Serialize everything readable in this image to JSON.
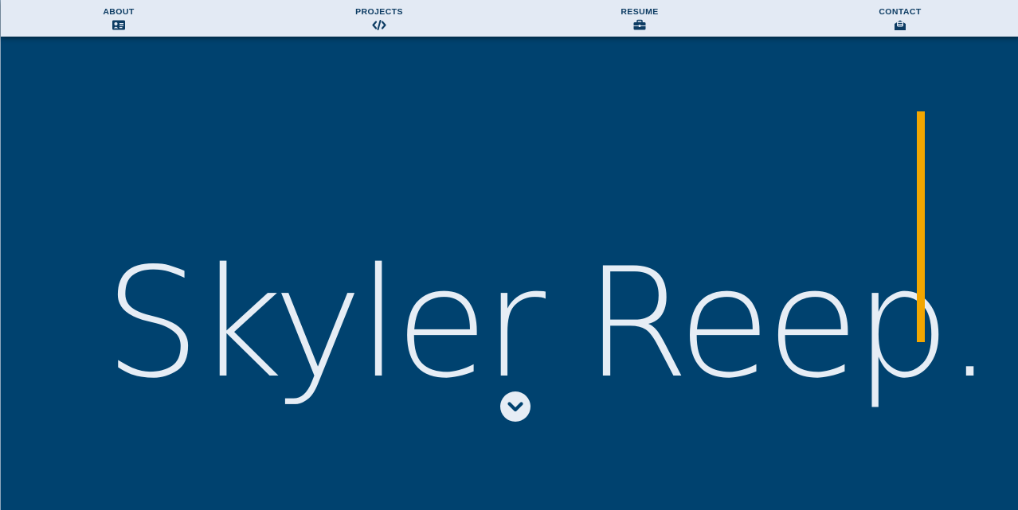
{
  "nav": {
    "items": [
      {
        "label": "ABOUT",
        "icon": "id-card-icon"
      },
      {
        "label": "PROJECTS",
        "icon": "code-icon"
      },
      {
        "label": "RESUME",
        "icon": "briefcase-icon"
      },
      {
        "label": "CONTACT",
        "icon": "envelope-open-icon"
      }
    ]
  },
  "hero": {
    "name": "Skyler Reep.",
    "scroll_icon": "chevron-down-circle-icon"
  },
  "colors": {
    "background": "#00426f",
    "navbar": "#e3eaf4",
    "nav_text": "#0d3c63",
    "hero_text": "#e6edf5",
    "cursor_accent": "#f2a600"
  }
}
